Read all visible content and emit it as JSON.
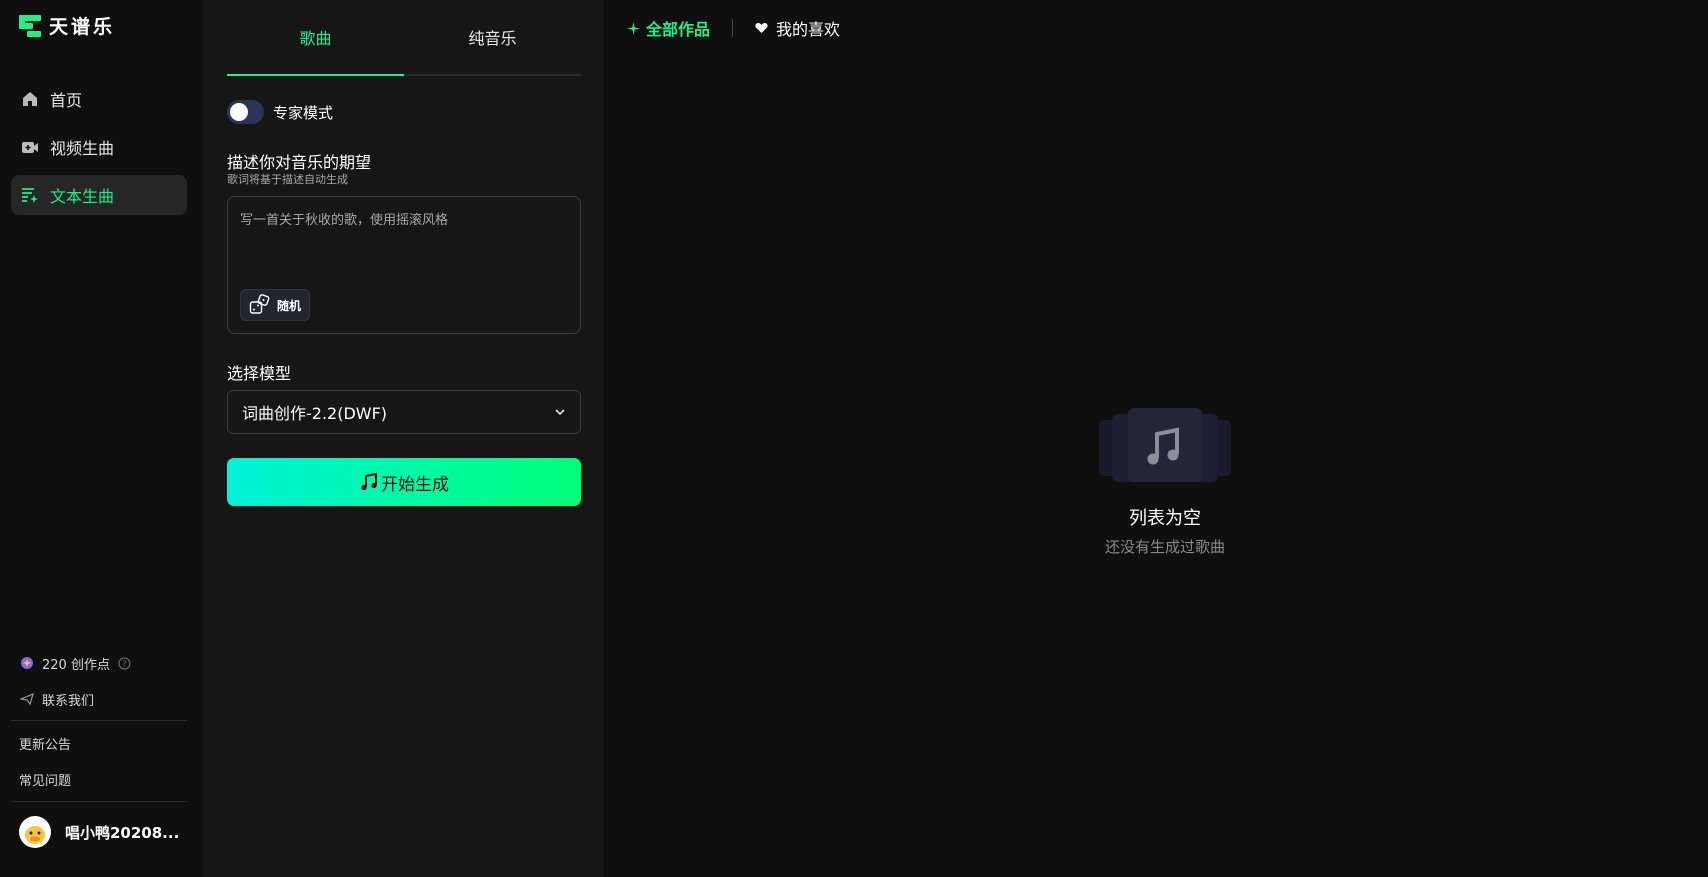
{
  "app": {
    "name": "天谱乐"
  },
  "sidebar": {
    "nav": [
      {
        "label": "首页",
        "icon": "home-icon"
      },
      {
        "label": "视频生曲",
        "icon": "video-plus-icon"
      },
      {
        "label": "文本生曲",
        "icon": "text-sparkle-icon",
        "active": true
      }
    ],
    "credits": "220 创作点",
    "contact": "联系我们",
    "links": [
      "更新公告",
      "常见问题"
    ],
    "user": {
      "name": "唱小鸭20208..."
    }
  },
  "panel": {
    "tabs": [
      {
        "label": "歌曲",
        "active": true
      },
      {
        "label": "纯音乐",
        "active": false
      }
    ],
    "expert_mode": {
      "label": "专家模式",
      "enabled": false
    },
    "description": {
      "title": "描述你对音乐的期望",
      "subtitle": "歌词将基于描述自动生成",
      "placeholder": "写一首关于秋收的歌，使用摇滚风格",
      "value": "",
      "random_label": "随机"
    },
    "model": {
      "title": "选择模型",
      "selected": "词曲创作-2.2(DWF)"
    },
    "generate_label": "开始生成"
  },
  "main": {
    "filters": {
      "all": "全部作品",
      "favorites": "我的喜欢"
    },
    "empty": {
      "title": "列表为空",
      "subtitle": "还没有生成过歌曲"
    }
  },
  "colors": {
    "accent": "#20f08a",
    "gradient_start": "#00f2d8",
    "gradient_end": "#00ff78",
    "panel_bg": "#161616",
    "page_bg": "#0f0f0f"
  }
}
